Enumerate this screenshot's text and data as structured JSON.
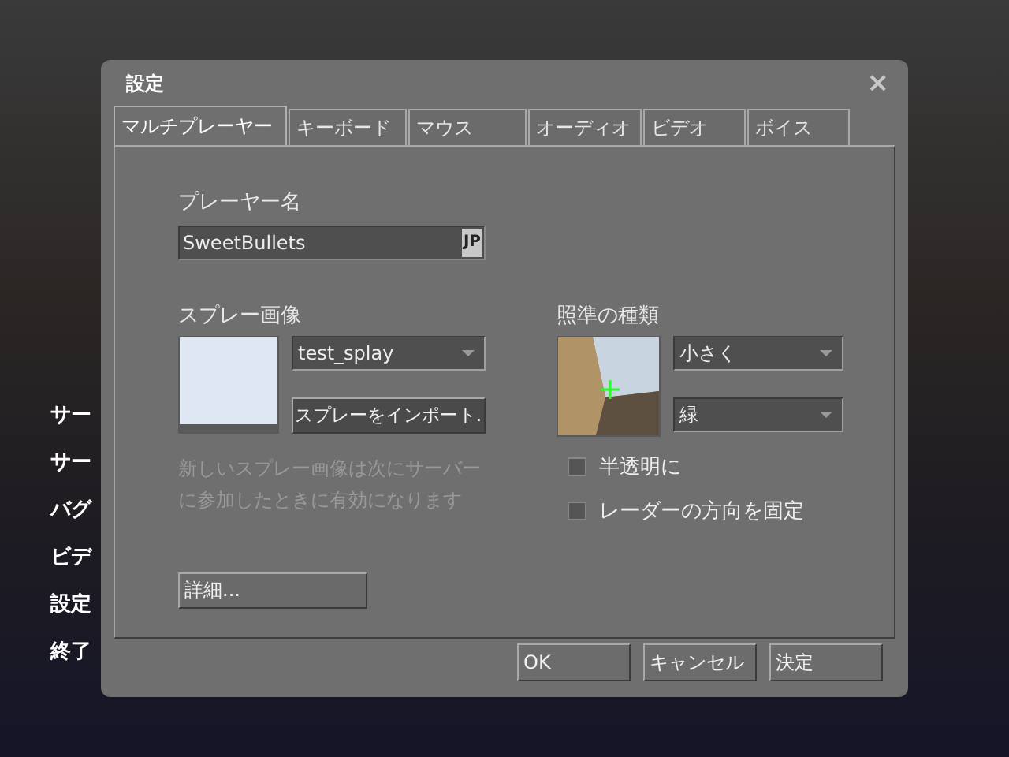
{
  "background_menu": [
    {
      "label": "サー"
    },
    {
      "label": "サー"
    },
    {
      "label": "バグ"
    },
    {
      "label": "ビデ"
    },
    {
      "label": "設定"
    },
    {
      "label": "終了"
    }
  ],
  "dialog": {
    "title": "設定",
    "close": "×"
  },
  "tabs": [
    {
      "label": "マルチプレーヤー",
      "selected": true
    },
    {
      "label": "キーボード",
      "selected": false
    },
    {
      "label": "マウス",
      "selected": false
    },
    {
      "label": "オーディオ",
      "selected": false
    },
    {
      "label": "ビデオ",
      "selected": false
    },
    {
      "label": "ボイス",
      "selected": false
    }
  ],
  "player_name": {
    "label": "プレーヤー名",
    "value": "SweetBullets",
    "ime_badge": "JP"
  },
  "spray": {
    "label": "スプレー画像",
    "selection": "test_splay",
    "import_button": "スプレーをインポート.",
    "hint": "新しいスプレー画像は次にサーバーに参加したときに有効になります"
  },
  "crosshair": {
    "label": "照準の種類",
    "size": "小さく",
    "color_choice": "緑"
  },
  "checkboxes": [
    {
      "label": "半透明に",
      "checked": false
    },
    {
      "label": "レーダーの方向を固定",
      "checked": false
    }
  ],
  "advanced_button": "詳細...",
  "buttons": [
    "OK",
    "キャンセル",
    "決定"
  ]
}
